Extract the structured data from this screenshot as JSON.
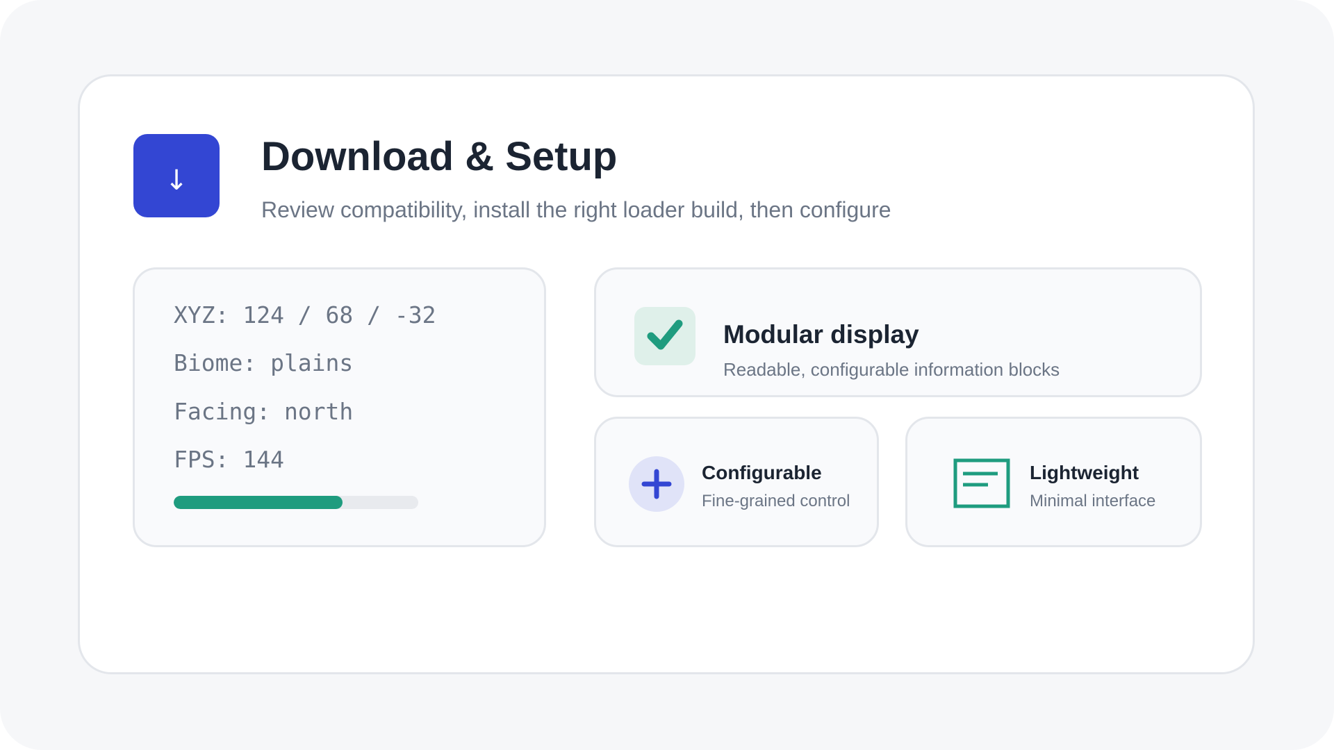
{
  "header": {
    "icon": "download-arrow-icon",
    "icon_glyph": "↓",
    "title": "Download & Setup",
    "subtitle": "Review compatibility, install the right loader build, then configure"
  },
  "stats": {
    "lines": [
      "XYZ: 124 / 68 / -32",
      "Biome: plains",
      "Facing: north",
      "FPS: 144"
    ],
    "progress_fraction": 0.69
  },
  "features": {
    "modular": {
      "icon": "checkmark-icon",
      "title": "Modular display",
      "description": "Readable, configurable information blocks"
    },
    "configurable": {
      "icon": "plus-icon",
      "title": "Configurable",
      "description": "Fine-grained control"
    },
    "lightweight": {
      "icon": "document-lines-icon",
      "title": "Lightweight",
      "description": "Minimal interface"
    }
  },
  "colors": {
    "accent_blue": "#3346d3",
    "accent_green": "#1f9c7f"
  }
}
